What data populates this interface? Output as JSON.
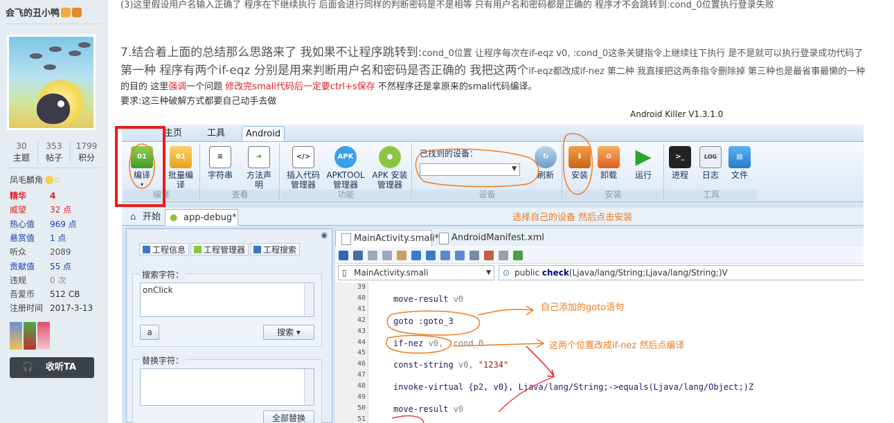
{
  "profile": {
    "username": "会飞的丑小鸭",
    "stats": [
      {
        "value": "30",
        "label": "主题"
      },
      {
        "value": "353",
        "label": "帖子"
      },
      {
        "value": "1799",
        "label": "积分"
      }
    ],
    "title": "凤毛麟角",
    "fields": [
      {
        "k": "精华",
        "v": "4",
        "c": "#e02020",
        "b": true
      },
      {
        "k": "威望",
        "v": "32 点",
        "c": "#e02020",
        "b": false
      },
      {
        "k": "热心值",
        "v": "969 点",
        "c": "#1a3fb0",
        "b": false
      },
      {
        "k": "悬赏值",
        "v": "1 点",
        "c": "#1a3fb0",
        "b": false
      },
      {
        "k": "听众",
        "v": "2089",
        "c": "#555",
        "b": false
      },
      {
        "k": "贡献值",
        "v": "55 点",
        "c": "#1a3fb0",
        "b": false
      },
      {
        "k": "违规",
        "v": "0 次",
        "c": "#888",
        "b": false
      },
      {
        "k": "吾爱币",
        "v": "512 CB",
        "c": "#333",
        "b": false
      },
      {
        "k": "注册时间",
        "v": "2017-3-13",
        "c": "#333",
        "b": false
      }
    ],
    "listen_label": "收听TA"
  },
  "post": {
    "line_top": "(3)这里假设用户名输入正确了 程序在下继续执行 后面会进行同样的判断密码是不是相等 只有用户名和密码都是正确的 程序才不会跳转到:cond_0位置执行登录失败",
    "h7a": "7.结合着上面的总结那么思路来了 我如果不让程序跳转到:",
    "h7b": "cond_0位置 让程序每次在if-eqz v0, :cond_0这条关键指令上继续往下执行 是不是就可以执行登录成功代码了",
    "h7c": "第一种 程序有两个if-eqz 分别是用来判断用户名和密码是否正确的 我把这两个",
    "h7d": "if-eqz都改成if-nez  第二种 我直接把这两条指令删除掉 第三种也是最省事最懒的一种",
    "l3a": "的目的 这里",
    "l3b": "强调",
    "l3c": "一个问题 ",
    "l3d": "修改完smali代码后一定要ctrl+s保存",
    "l3e": " 不然程序还是拿原来的smali代码编译。",
    "l4": "要求:这三种破解方式都要自己动手去做",
    "caption": "Android Killer V1.3.1.0"
  },
  "ak": {
    "tabs": [
      "主页",
      "工具",
      "Android"
    ],
    "groups": [
      "编译",
      "查看",
      "功能",
      "设备",
      "安装",
      "工具"
    ],
    "buttons": [
      "编译",
      "批量编\n译",
      "字符串",
      "方法声\n明",
      "插入代码\n管理器",
      "APKTOOL\n管理器",
      "APK 安装\n管理器",
      "刷新",
      "安装",
      "卸载",
      "运行",
      "进程",
      "日志",
      "文件"
    ],
    "device_label": "已找到的设备：",
    "win_tabs": [
      "开始",
      "app-debug*"
    ],
    "panel_tabs": [
      "工程信息",
      "工程管理器",
      "工程搜索"
    ],
    "search_label": "搜索字符：",
    "search_value": "onClick",
    "search_btn": "搜索",
    "replace_label": "替换字符：",
    "replace_btn": "全部替换",
    "editor_tabs": [
      "MainActivity.smali*",
      "AndroidManifest.xml"
    ],
    "file_combo": "MainActivity.smali",
    "method_combo_kw": "public ",
    "method_combo_name": "check",
    "method_combo_sig": "(Ljava/lang/String;Ljava/lang/String;)V",
    "line_numbers": [
      "39",
      "40",
      "41",
      "42",
      "43",
      "44",
      "45",
      "46",
      "47",
      "48",
      "49",
      "50",
      "51"
    ],
    "code": {
      "l40a": "move-result ",
      "l40b": "v0",
      "l42a": "goto ",
      "l42b": ":goto_3",
      "l44a": "if-nez ",
      "l44b": "v0, :cond_0",
      "l46a": "const-string ",
      "l46b": "v0, ",
      "l46c": "\"1234\"",
      "l48": "invoke-virtual {p2, v0}, Ljava/lang/String;->equals(Ljava/lang/Object;)Z",
      "l50a": "move-result ",
      "l50b": "v0"
    }
  },
  "annotations": {
    "select_device": "选择自己的设备 然后点击安装",
    "goto_note": "自己添加的goto语句",
    "ifnez_note": "这两个位置改成if-nez 然后点编译"
  }
}
